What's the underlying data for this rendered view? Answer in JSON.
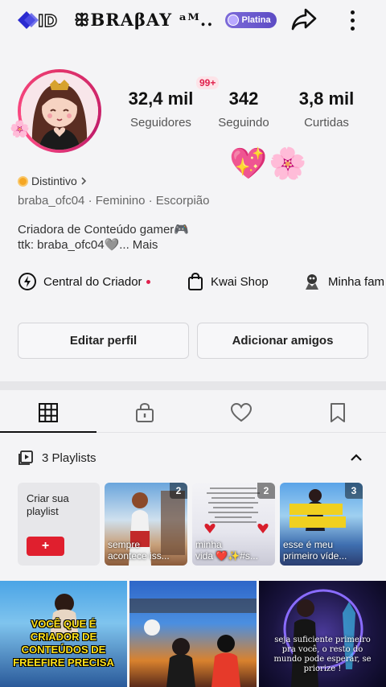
{
  "header": {
    "nickname": "ꕥBRAβAY ᵃᴹ..",
    "level_badge": "Platina"
  },
  "stats": {
    "notif_badge": "99+",
    "items": [
      {
        "value": "32,4 mil",
        "label": "Seguidores"
      },
      {
        "value": "342",
        "label": "Seguindo"
      },
      {
        "value": "3,8 mil",
        "label": "Curtidas"
      }
    ]
  },
  "profile": {
    "emojis": "💖🌸",
    "distintivo": "Distintivo",
    "meta": "braba_ofc04 · Feminino · Escorpião",
    "bio_line1": "Criadora de Conteúdo gamer🎮",
    "bio_line2": "ttk: braba_ofc04🩶...",
    "more_label": "Mais"
  },
  "quick_links": [
    {
      "label": "Central do Criador",
      "icon": "lightning-icon"
    },
    {
      "label": "Kwai Shop",
      "icon": "shopping-bag-icon"
    },
    {
      "label": "Minha fam",
      "icon": "family-icon"
    }
  ],
  "buttons": {
    "edit": "Editar perfil",
    "add_friends": "Adicionar amigos"
  },
  "tabs": [
    "grid-icon",
    "lock-icon",
    "heart-icon",
    "bookmark-icon"
  ],
  "playlists": {
    "header": "3 Playlists",
    "create_label": "Criar sua playlist",
    "create_button": "+",
    "items": [
      {
        "count": "2",
        "line1": "sempre",
        "line2": "acontece iss..."
      },
      {
        "count": "2",
        "line1": "minha",
        "line2": "vida ❤️✨#s..."
      },
      {
        "count": "3",
        "line1": "esse é meu",
        "line2": "primeiro víde..."
      }
    ]
  },
  "videos": [
    {
      "caption": "VOCÊ QUE É CRIADOR DE CONTEÚDOS DE FREEFIRE PRECISA"
    },
    {
      "caption": ""
    },
    {
      "caption": "seja suficiente primeiro pra você, o resto do mundo pode esperar, se priorize !"
    }
  ]
}
